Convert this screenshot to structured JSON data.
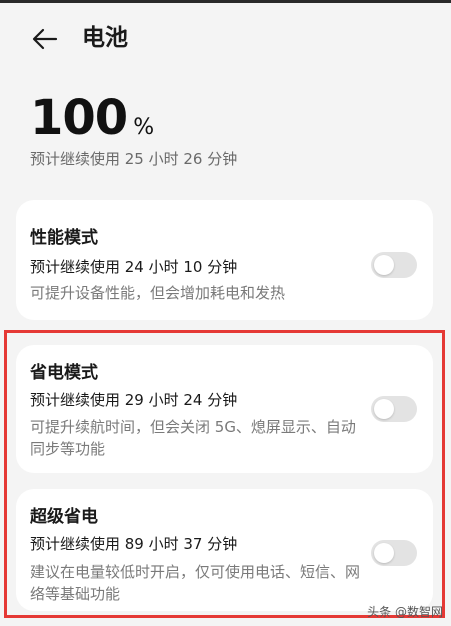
{
  "header": {
    "back_icon": "arrow-left-icon",
    "title": "电池"
  },
  "battery": {
    "percent_value": "100",
    "percent_unit": "%",
    "remaining": "预计继续使用 25 小时 26 分钟"
  },
  "modes": [
    {
      "title": "性能模式",
      "estimate": "预计继续使用 24 小时 10 分钟",
      "description": "可提升设备性能，但会增加耗电和发热",
      "enabled": false
    },
    {
      "title": "省电模式",
      "estimate": "预计继续使用 29 小时 24 分钟",
      "description": "可提升续航时间，但会关闭 5G、熄屏显示、自动同步等功能",
      "enabled": false
    },
    {
      "title": "超级省电",
      "estimate": "预计继续使用 89 小时 37 分钟",
      "description": "建议在电量较低时开启，仅可使用电话、短信、网络等基础功能",
      "enabled": false
    }
  ],
  "highlight_color": "#e53935",
  "watermark": "头条 @数智网"
}
